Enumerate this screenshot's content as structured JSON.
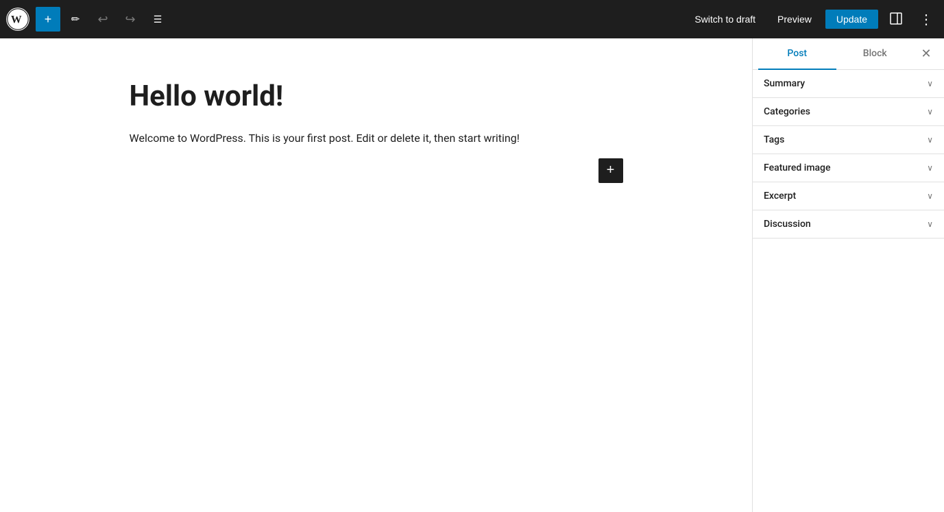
{
  "toolbar": {
    "add_label": "+",
    "switch_to_draft_label": "Switch to draft",
    "preview_label": "Preview",
    "update_label": "Update"
  },
  "editor": {
    "post_title": "Hello world!",
    "post_body": "Welcome to WordPress. This is your first post. Edit or delete it, then start writing!"
  },
  "sidebar": {
    "tab_post_label": "Post",
    "tab_block_label": "Block",
    "panels": [
      {
        "id": "summary",
        "title": "Summary"
      },
      {
        "id": "categories",
        "title": "Categories"
      },
      {
        "id": "tags",
        "title": "Tags"
      },
      {
        "id": "featured-image",
        "title": "Featured image"
      },
      {
        "id": "excerpt",
        "title": "Excerpt"
      },
      {
        "id": "discussion",
        "title": "Discussion"
      }
    ]
  },
  "icons": {
    "plus": "+",
    "pencil": "✏",
    "undo": "↩",
    "redo": "↪",
    "list_view": "☰",
    "close": "✕",
    "chevron_down": "∨",
    "sidebar_toggle": "⬚",
    "more": "⋮"
  }
}
